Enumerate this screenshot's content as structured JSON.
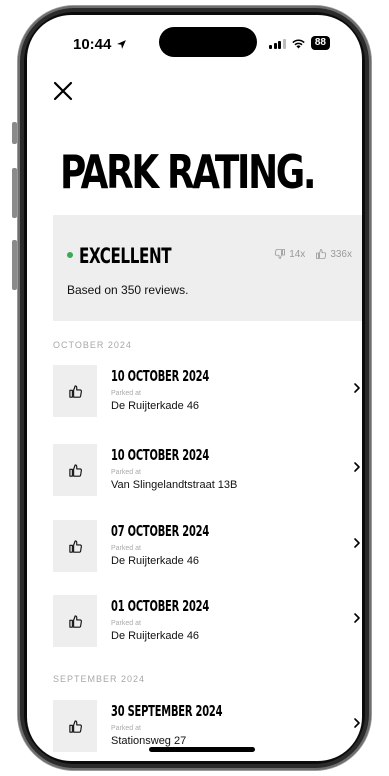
{
  "status": {
    "time": "10:44",
    "battery": "88"
  },
  "title": "PARK RATING.",
  "summary": {
    "label": "EXCELLENT",
    "status_color": "#3aaa55",
    "dislikes": "14x",
    "likes": "336x",
    "reviews": "Based on 350 reviews."
  },
  "sections": [
    {
      "label": "OCTOBER 2024",
      "items": [
        {
          "date": "10 OCTOBER 2024",
          "parked_label": "Parked at",
          "address": "De Ruijterkade 46"
        },
        {
          "date": "10 OCTOBER 2024",
          "parked_label": "Parked at",
          "address": "Van Slingelandtstraat 13B"
        },
        {
          "date": "07 OCTOBER 2024",
          "parked_label": "Parked at",
          "address": "De Ruijterkade 46"
        },
        {
          "date": "01 OCTOBER 2024",
          "parked_label": "Parked at",
          "address": "De Ruijterkade 46"
        }
      ]
    },
    {
      "label": "SEPTEMBER 2024",
      "items": [
        {
          "date": "30 SEPTEMBER 2024",
          "parked_label": "Parked at",
          "address": "Stationsweg 27"
        }
      ]
    }
  ],
  "icons": {
    "close": "close-icon",
    "like": "thumbs-up-icon",
    "dislike": "thumbs-down-icon",
    "chevron": "chevron-right-icon",
    "location": "location-arrow-icon"
  }
}
